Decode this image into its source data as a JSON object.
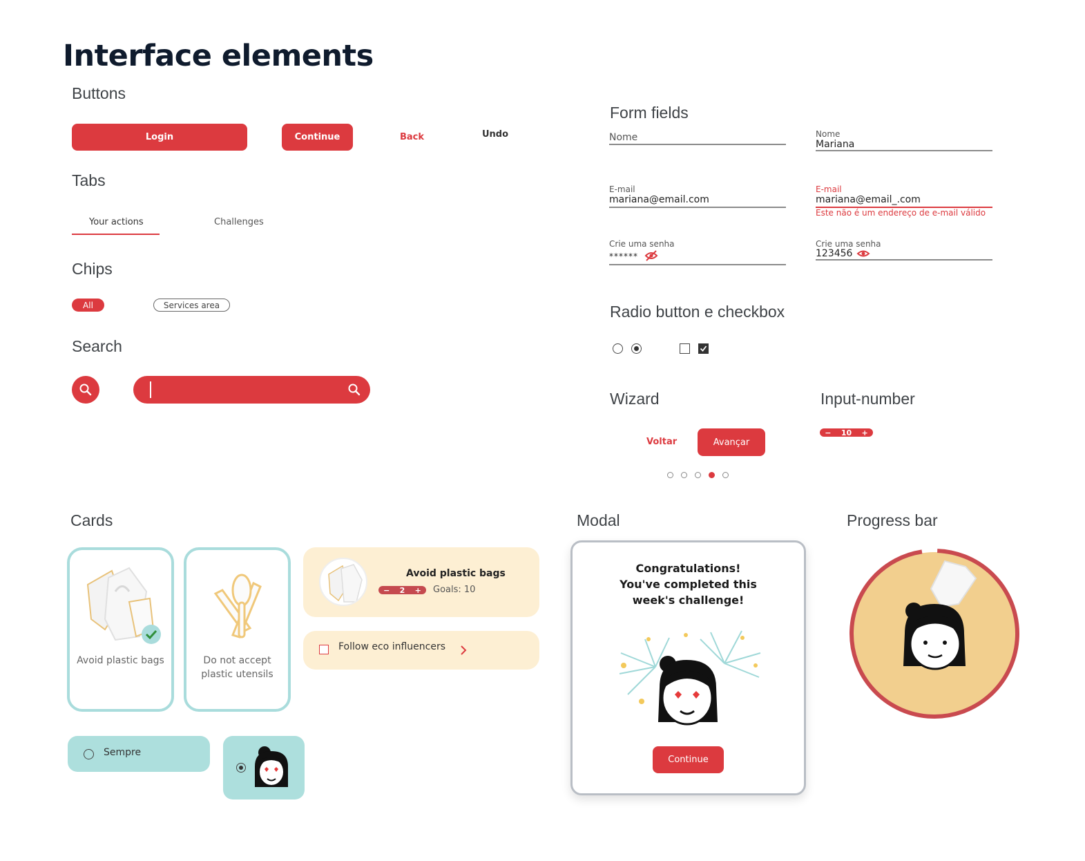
{
  "page": {
    "title": "Interface elements"
  },
  "buttons": {
    "heading": "Buttons",
    "login": "Login",
    "continue": "Continue",
    "back": "Back",
    "undo": "Undo"
  },
  "tabs": {
    "heading": "Tabs",
    "items": [
      {
        "label": "Your actions"
      },
      {
        "label": "Challenges"
      }
    ]
  },
  "chips": {
    "heading": "Chips",
    "items": [
      {
        "label": "All"
      },
      {
        "label": "Services area"
      }
    ]
  },
  "search": {
    "heading": "Search",
    "value": ""
  },
  "form": {
    "heading": "Form fields",
    "nome_placeholder": "Nome",
    "nome_label": "Nome",
    "nome_value": "Mariana",
    "email_label": "E-mail",
    "email_value": "mariana@email.com",
    "email_error_label": "E-mail",
    "email_error_value": "mariana@email_.com",
    "email_error_msg": "Este não é um endereço de e-mail válido",
    "password_label": "Crie uma senha",
    "password_masked": "******",
    "password_label2": "Crie uma senha",
    "password_value": "123456"
  },
  "radio_checkbox": {
    "heading": "Radio button e checkbox"
  },
  "wizard": {
    "heading": "Wizard",
    "back": "Voltar",
    "next": "Avançar",
    "steps": 5,
    "active_step": 4
  },
  "input_number": {
    "heading": "Input-number",
    "value": "10",
    "minus": "−",
    "plus": "+"
  },
  "cards": {
    "heading": "Cards",
    "card1_label": "Avoid plastic bags",
    "card2_label": "Do not accept plastic utensils",
    "wide_title": "Avoid plastic bags",
    "wide_stepper_value": "2",
    "wide_goals": "Goals: 10",
    "follow_label": "Follow eco influencers",
    "option_label": "Sempre"
  },
  "modal": {
    "heading": "Modal",
    "message": "Congratulations! You've completed this week's challenge!",
    "button": "Continue"
  },
  "progress": {
    "heading": "Progress bar",
    "value": 0.97
  },
  "colors": {
    "accent": "#dc3a3f",
    "teal": "#a9dcdc",
    "cream": "#fdefd3",
    "yellow": "#f2cf8e"
  }
}
